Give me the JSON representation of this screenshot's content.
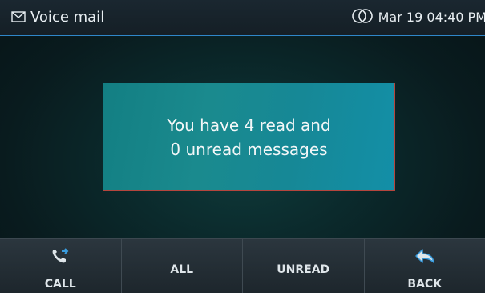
{
  "header": {
    "title": "Voice mail",
    "datetime": "Mar 19 04:40 PM",
    "title_icon": "envelope-icon",
    "status_icon": "linked-circles-icon"
  },
  "message": {
    "line1": "You have 4 read and",
    "line2": "0 unread messages"
  },
  "softkeys": [
    {
      "label": "CALL",
      "icon": "phone-icon"
    },
    {
      "label": "ALL"
    },
    {
      "label": "UNREAD"
    },
    {
      "label": "BACK",
      "icon": "back-arrow-icon"
    }
  ],
  "colors": {
    "accent": "#2f87c9",
    "message_border": "#b5453d",
    "message_bg": "#168896"
  }
}
